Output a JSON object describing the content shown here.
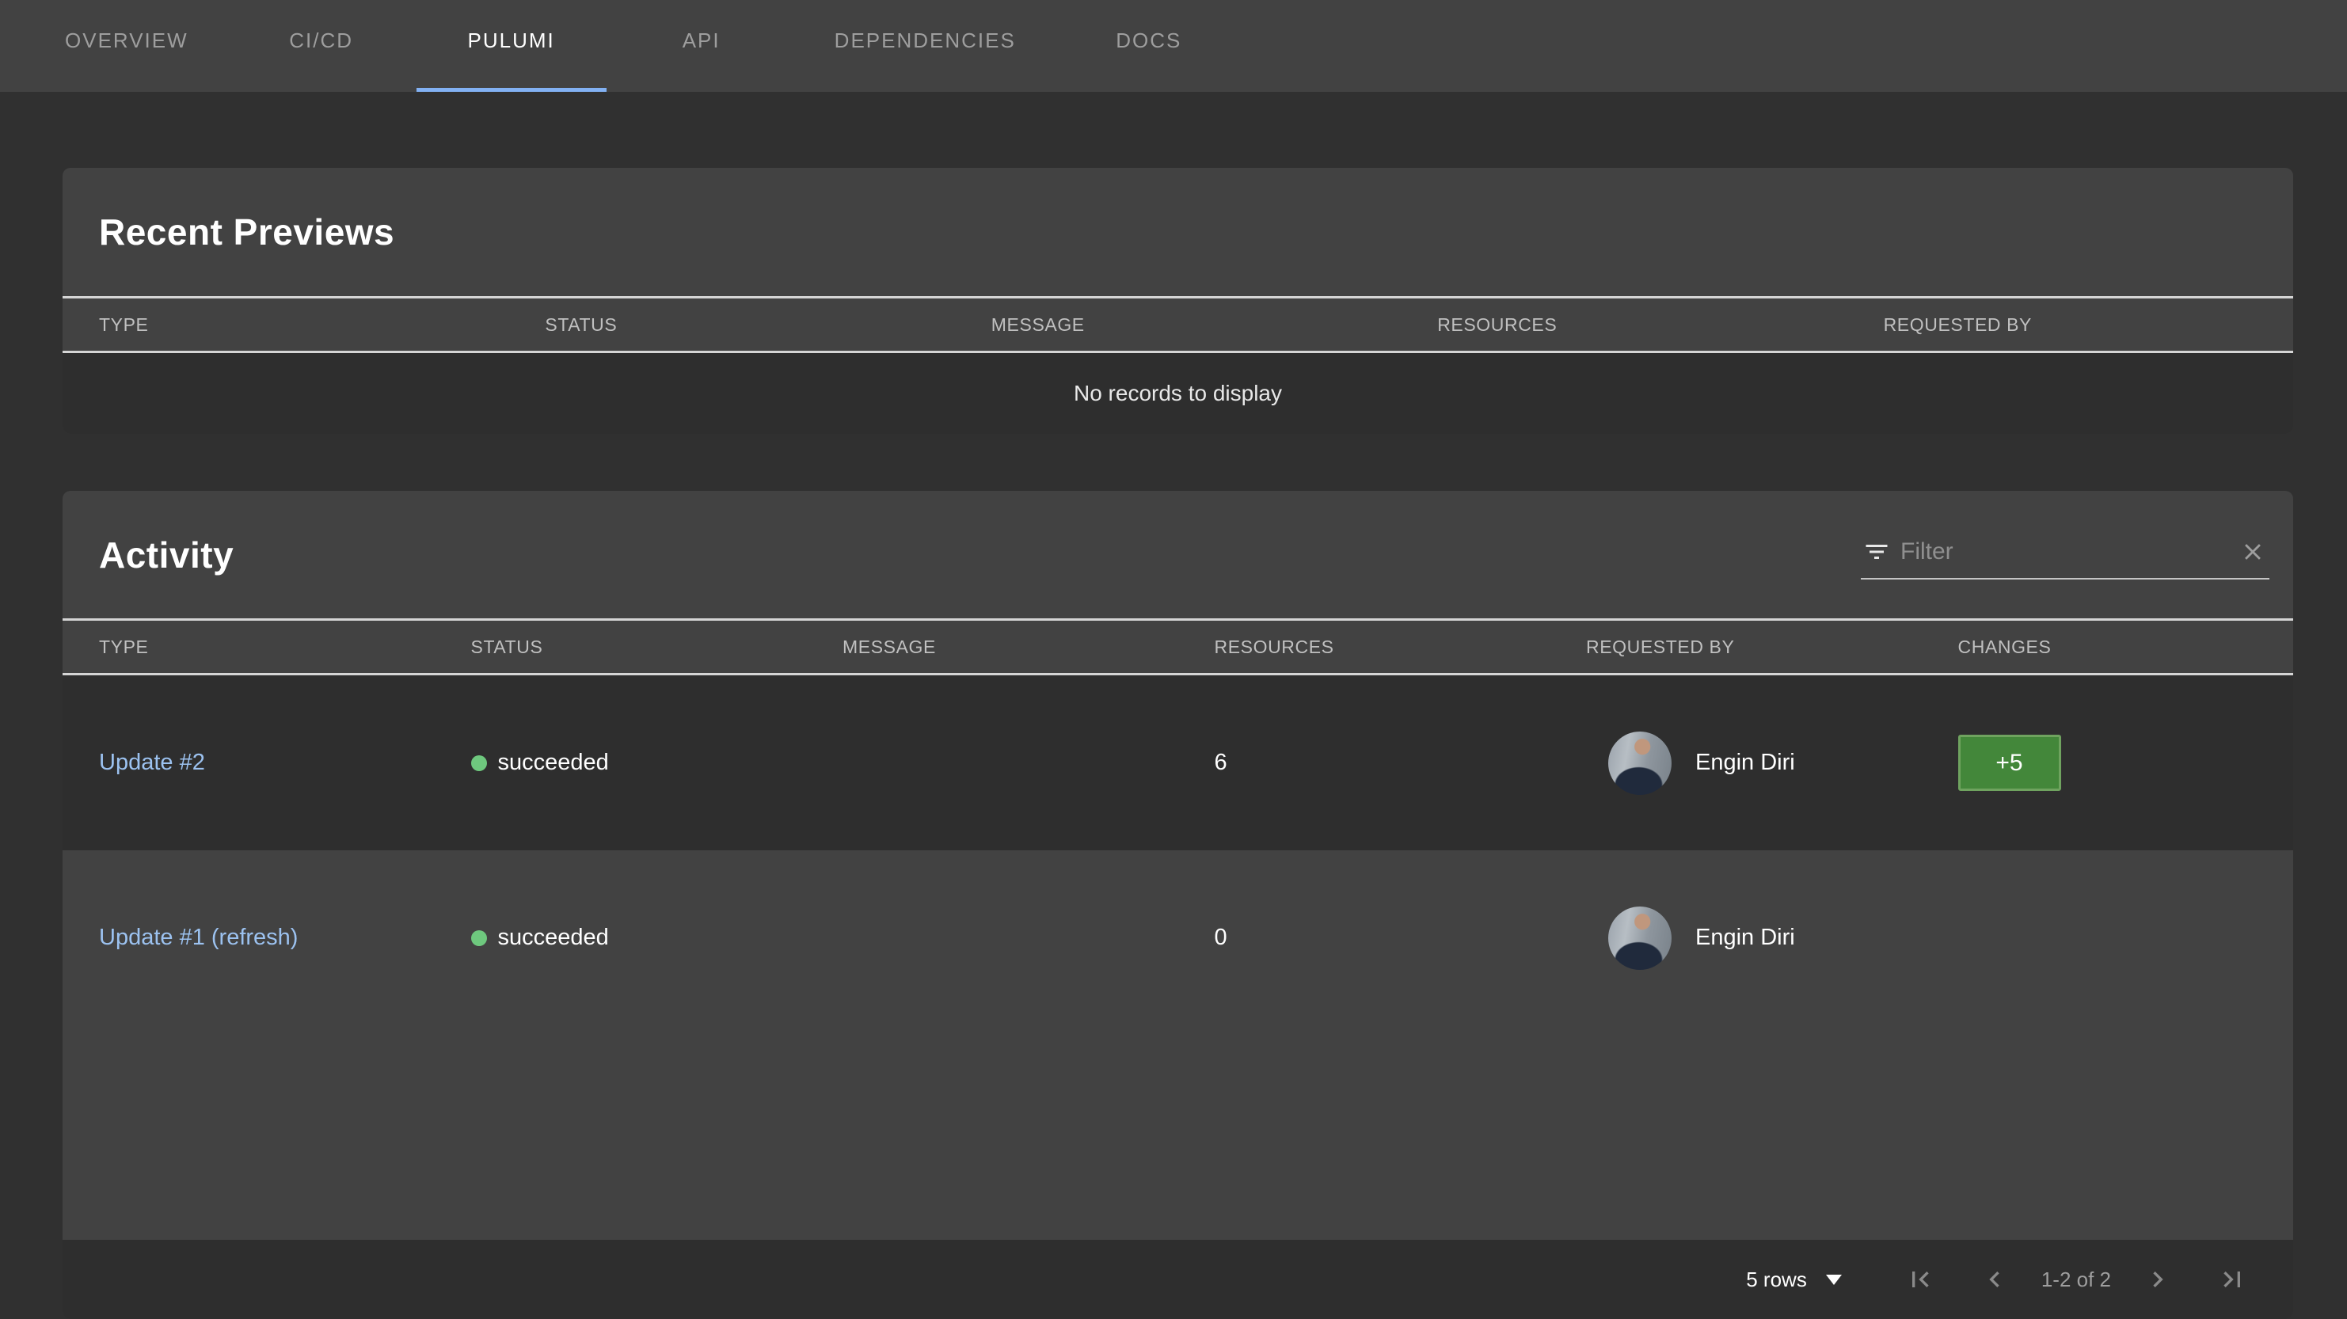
{
  "tabs": {
    "items": [
      {
        "label": "OVERVIEW",
        "active": false
      },
      {
        "label": "CI/CD",
        "active": false
      },
      {
        "label": "PULUMI",
        "active": true
      },
      {
        "label": "API",
        "active": false
      },
      {
        "label": "DEPENDENCIES",
        "active": false
      },
      {
        "label": "DOCS",
        "active": false
      }
    ]
  },
  "recent_previews": {
    "title": "Recent Previews",
    "columns": [
      "TYPE",
      "STATUS",
      "MESSAGE",
      "RESOURCES",
      "REQUESTED BY"
    ],
    "empty_message": "No records to display"
  },
  "activity": {
    "title": "Activity",
    "filter": {
      "placeholder": "Filter",
      "filter_icon": "filter-list-icon",
      "clear_icon": "close-icon"
    },
    "columns": [
      "TYPE",
      "STATUS",
      "MESSAGE",
      "RESOURCES",
      "REQUESTED BY",
      "CHANGES"
    ],
    "rows": [
      {
        "type": "Update #2",
        "status": "succeeded",
        "message": "",
        "resources": "6",
        "requested_by": "Engin Diri",
        "changes": "+5"
      },
      {
        "type": "Update #1 (refresh)",
        "status": "succeeded",
        "message": "",
        "resources": "0",
        "requested_by": "Engin Diri",
        "changes": ""
      }
    ],
    "pagination": {
      "rows_per_page": "5 rows",
      "range": "1-2 of 2",
      "icons": [
        "arrow-drop-down-icon",
        "first-page-icon",
        "chevron-left-icon",
        "chevron-right-icon",
        "last-page-icon"
      ]
    }
  },
  "colors": {
    "page_bg": "#303030",
    "card_bg": "#424242",
    "row_alt_bg": "#2e2e2e",
    "tab_accent_blue": "#82b1f3",
    "link_blue": "#9cc2f0",
    "success_green": "#6ec87e",
    "changes_green": "#43873a",
    "header_divider": "#d5d5d5"
  }
}
